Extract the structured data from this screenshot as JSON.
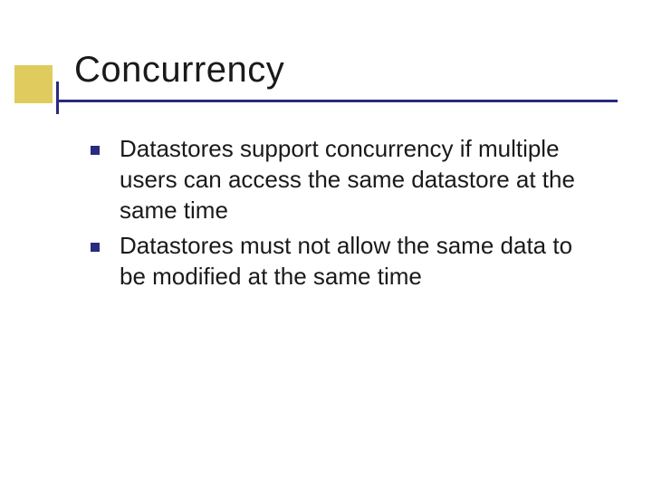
{
  "slide": {
    "title": "Concurrency",
    "bullets": [
      "Datastores support concurrency if multiple users can access the same datastore at the same time",
      "Datastores must not allow the same data to be modified at the same time"
    ]
  }
}
